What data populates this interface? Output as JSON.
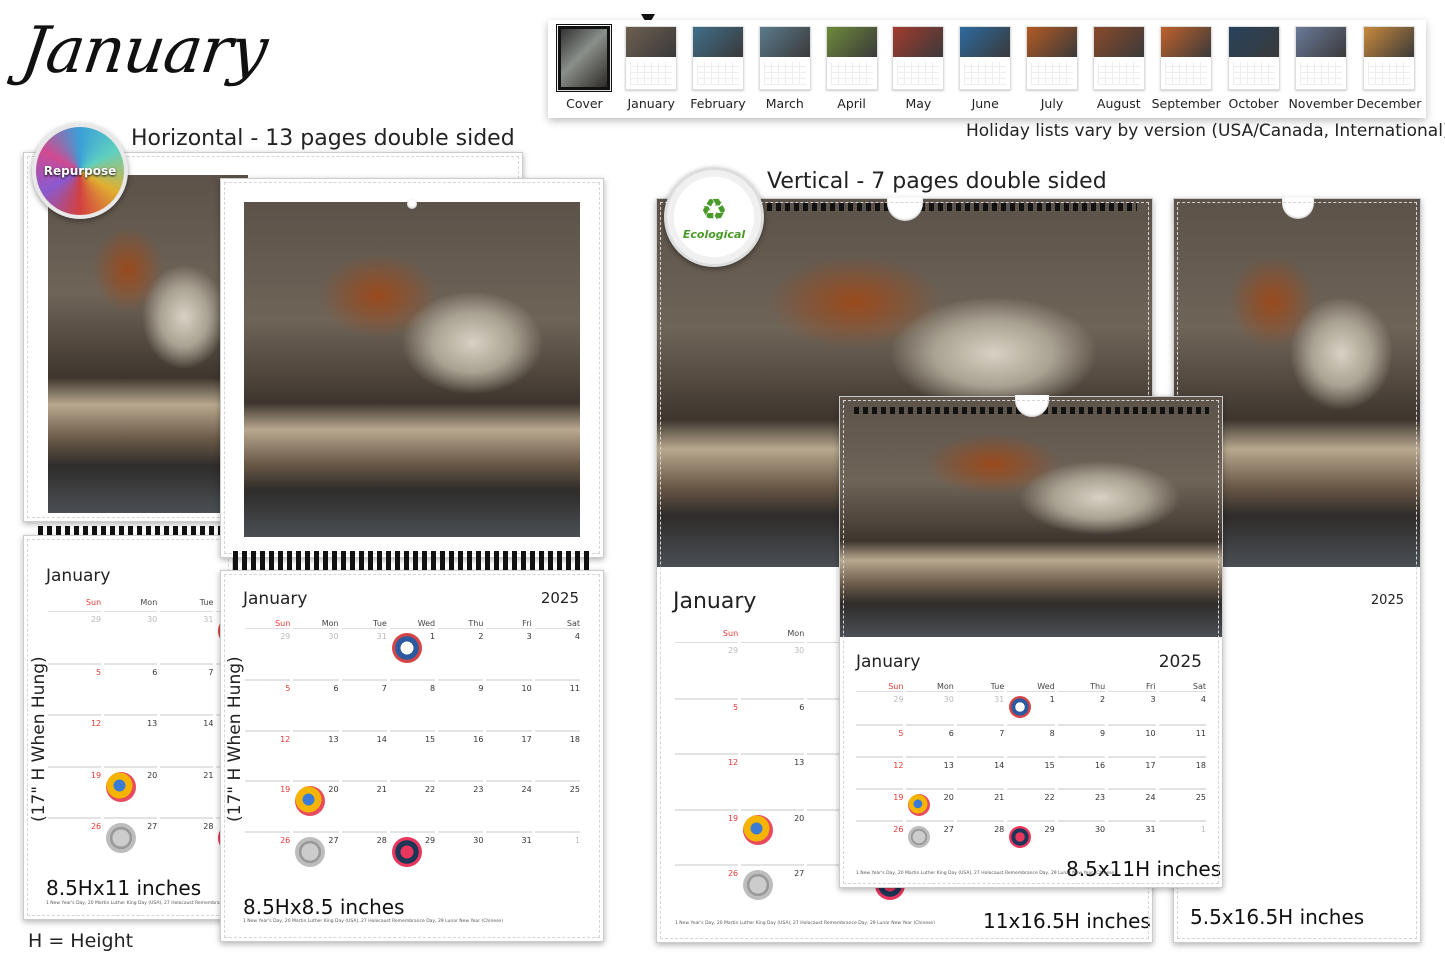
{
  "header": {
    "month_script_title": "January",
    "horizontal_heading": "Horizontal - 13 pages double sided",
    "vertical_heading": "Vertical - 7 pages double sided",
    "holiday_note": "Holiday lists vary by version (USA/Canada, International)",
    "height_legend": "H = Height"
  },
  "badges": {
    "repurpose": "Repurpose",
    "ecological": "Ecological"
  },
  "thumbnails": {
    "selected": "January",
    "items": [
      {
        "label": "Cover",
        "accent": "#6b7068"
      },
      {
        "label": "January",
        "accent": "#6e5f50"
      },
      {
        "label": "February",
        "accent": "#3f6f8a"
      },
      {
        "label": "March",
        "accent": "#5a7b8c"
      },
      {
        "label": "April",
        "accent": "#6d8a3a"
      },
      {
        "label": "May",
        "accent": "#a33b2e"
      },
      {
        "label": "June",
        "accent": "#2c6aa0"
      },
      {
        "label": "July",
        "accent": "#b45a22"
      },
      {
        "label": "August",
        "accent": "#8a4a2a"
      },
      {
        "label": "September",
        "accent": "#c0612b"
      },
      {
        "label": "October",
        "accent": "#27435e"
      },
      {
        "label": "November",
        "accent": "#6a7a99"
      },
      {
        "label": "December",
        "accent": "#c98a3a"
      }
    ]
  },
  "calendar": {
    "month": "January",
    "year": "2025",
    "weekdays": [
      "Sun",
      "Mon",
      "Tue",
      "Wed",
      "Thu",
      "Fri",
      "Sat"
    ],
    "weeks": [
      [
        "29",
        "30",
        "31",
        "1",
        "2",
        "3",
        "4"
      ],
      [
        "5",
        "6",
        "7",
        "8",
        "9",
        "10",
        "11"
      ],
      [
        "12",
        "13",
        "14",
        "15",
        "16",
        "17",
        "18"
      ],
      [
        "19",
        "20",
        "21",
        "22",
        "23",
        "24",
        "25"
      ],
      [
        "26",
        "27",
        "28",
        "29",
        "30",
        "31",
        "1"
      ]
    ],
    "muted_days": [
      "0-0",
      "0-1",
      "0-2",
      "4-6"
    ],
    "holiday_stickers": [
      {
        "cell": "0-3",
        "holiday": "New Year's Day",
        "icon": "new-year-sticker"
      },
      {
        "cell": "3-1",
        "holiday": "Martin Luther King Day (USA)",
        "icon": "mlk-sticker"
      },
      {
        "cell": "4-1",
        "holiday": "Holocaust Remembrance Day",
        "icon": "star-of-david-coin-sticker"
      },
      {
        "cell": "4-3",
        "holiday": "Lunar New Year (Chinese)",
        "icon": "dragon-sticker"
      }
    ],
    "footnote": "1 New Year's Day, 20 Martin Luther King Day (USA), 27 Holocaust Remembrance Day, 29 Lunar New Year (Chinese)",
    "accent_sunday": "#e53935"
  },
  "products": {
    "h_8_5x11": {
      "size": "8.5Hx11 inches",
      "hung_note": "(17\" H When Hung)"
    },
    "h_8_5x8_5": {
      "size": "8.5Hx8.5 inches",
      "hung_note": "(17\" H When Hung)"
    },
    "v_11x16_5": {
      "size": "11x16.5H inches"
    },
    "v_8_5x11": {
      "size": "8.5x11H inches"
    },
    "v_5_5x16_5": {
      "size": "5.5x16.5H inches"
    }
  }
}
